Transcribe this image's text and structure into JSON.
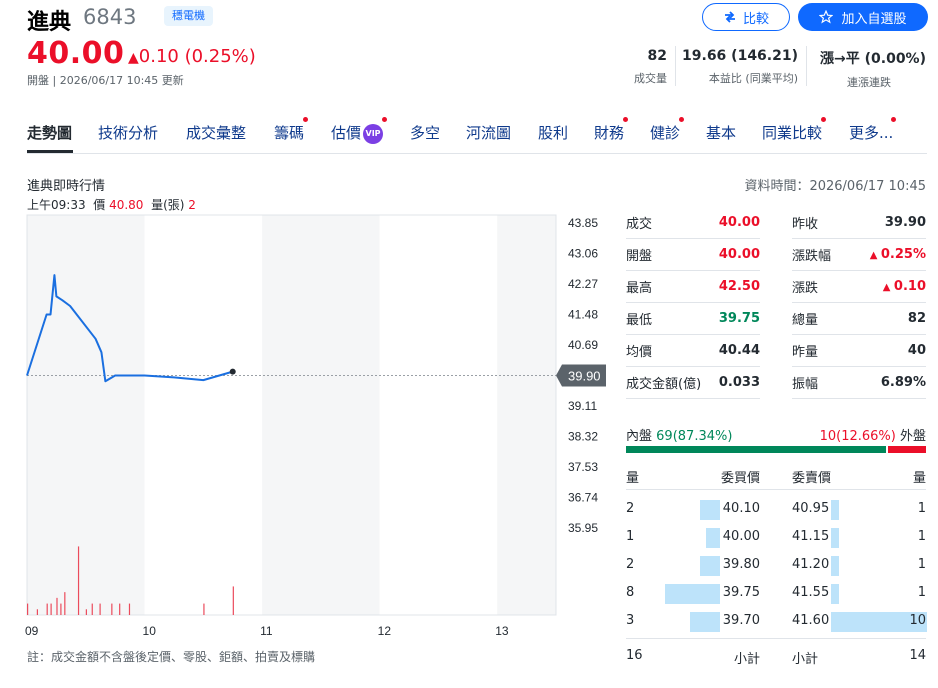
{
  "stock": {
    "name": "進典",
    "code": "6843",
    "industry": "穩電機",
    "price": "40.00",
    "change": "0.10 (0.25%)",
    "market_status": "開盤",
    "updated": "2026/06/17 10:45 更新"
  },
  "buttons": {
    "compare": "比較",
    "watchlist": "加入自選股"
  },
  "header_stats": [
    {
      "value": "82",
      "label": "成交量"
    },
    {
      "value": "19.66 (146.21)",
      "label": "本益比 (同業平均)"
    },
    {
      "value": "漲→平 (0.00%)",
      "label": "連漲連跌"
    }
  ],
  "tabs": [
    {
      "label": "走勢圖",
      "active": true
    },
    {
      "label": "技術分析"
    },
    {
      "label": "成交彙整"
    },
    {
      "label": "籌碼"
    },
    {
      "label": "估價",
      "badge": "VIP"
    },
    {
      "label": "多空"
    },
    {
      "label": "河流圖"
    },
    {
      "label": "股利"
    },
    {
      "label": "財務"
    },
    {
      "label": "健診"
    },
    {
      "label": "基本"
    },
    {
      "label": "同業比較"
    },
    {
      "label": "更多..."
    }
  ],
  "chart_section": {
    "title": "進典即時行情",
    "data_time": "資料時間：2026/06/17 10:45",
    "tooltip": {
      "time": "上午09:33",
      "price_label": "價",
      "price": "40.80",
      "volume_label": "量(張)",
      "volume": "2"
    },
    "footnote": "註：成交金額不含盤後定價、零股、鉅額、拍賣及標購"
  },
  "chart_data": {
    "type": "line",
    "y_ticks": [
      "43.85",
      "43.06",
      "42.27",
      "41.48",
      "40.69",
      "39.90",
      "39.11",
      "38.32",
      "37.53",
      "36.74",
      "35.95"
    ],
    "x_ticks": [
      "09",
      "10",
      "11",
      "12",
      "13"
    ],
    "reference_price": "39.90",
    "ylim": [
      35.95,
      43.85
    ],
    "price_series": [
      {
        "t": "09:00",
        "v": 39.9
      },
      {
        "t": "09:10",
        "v": 41.48
      },
      {
        "t": "09:12",
        "v": 41.48
      },
      {
        "t": "09:14",
        "v": 42.5
      },
      {
        "t": "09:15",
        "v": 41.95
      },
      {
        "t": "09:18",
        "v": 41.85
      },
      {
        "t": "09:22",
        "v": 41.7
      },
      {
        "t": "09:35",
        "v": 40.85
      },
      {
        "t": "09:38",
        "v": 40.5
      },
      {
        "t": "09:40",
        "v": 39.75
      },
      {
        "t": "09:45",
        "v": 39.9
      },
      {
        "t": "10:00",
        "v": 39.9
      },
      {
        "t": "10:15",
        "v": 39.85
      },
      {
        "t": "10:30",
        "v": 39.78
      },
      {
        "t": "10:45",
        "v": 40.0
      }
    ],
    "volume_series": [
      {
        "t": "09:00",
        "v": 2
      },
      {
        "t": "09:05",
        "v": 1
      },
      {
        "t": "09:10",
        "v": 2
      },
      {
        "t": "09:12",
        "v": 2
      },
      {
        "t": "09:15",
        "v": 3
      },
      {
        "t": "09:17",
        "v": 2
      },
      {
        "t": "09:19",
        "v": 4
      },
      {
        "t": "09:26",
        "v": 12
      },
      {
        "t": "09:30",
        "v": 1
      },
      {
        "t": "09:33",
        "v": 2
      },
      {
        "t": "09:37",
        "v": 2
      },
      {
        "t": "09:43",
        "v": 2
      },
      {
        "t": "09:47",
        "v": 2
      },
      {
        "t": "09:52",
        "v": 2
      },
      {
        "t": "10:30",
        "v": 2
      },
      {
        "t": "10:45",
        "v": 5
      }
    ],
    "volume_max": 14
  },
  "quote_table": {
    "left": [
      {
        "label": "成交",
        "value": "40.00",
        "color": "red"
      },
      {
        "label": "開盤",
        "value": "40.00",
        "color": "red"
      },
      {
        "label": "最高",
        "value": "42.50",
        "color": "red"
      },
      {
        "label": "最低",
        "value": "39.75",
        "color": "green"
      },
      {
        "label": "均價",
        "value": "40.44",
        "color": ""
      },
      {
        "label": "成交金額(億)",
        "value": "0.033",
        "color": ""
      }
    ],
    "right": [
      {
        "label": "昨收",
        "value": "39.90",
        "color": ""
      },
      {
        "label": "漲跌幅",
        "value": "0.25%",
        "color": "red",
        "arrow": true
      },
      {
        "label": "漲跌",
        "value": "0.10",
        "color": "red",
        "arrow": true
      },
      {
        "label": "總量",
        "value": "82",
        "color": ""
      },
      {
        "label": "昨量",
        "value": "40",
        "color": ""
      },
      {
        "label": "振幅",
        "value": "6.89%",
        "color": ""
      }
    ]
  },
  "inner_outer": {
    "inner_label": "內盤",
    "inner_value": "69",
    "inner_pct": "(87.34%)",
    "outer_value": "10",
    "outer_pct": "(12.66%)",
    "outer_label": "外盤",
    "inner_fraction": 0.8734
  },
  "order_book": {
    "headers": {
      "bid_qty": "量",
      "bid_price": "委買價",
      "ask_price": "委賣價",
      "ask_qty": "量"
    },
    "rows": [
      {
        "bid_qty": "2",
        "bid_price": "40.10",
        "ask_price": "40.95",
        "ask_qty": "1",
        "bid_n": 2,
        "ask_n": 1
      },
      {
        "bid_qty": "1",
        "bid_price": "40.00",
        "ask_price": "41.15",
        "ask_qty": "1",
        "bid_n": 1,
        "ask_n": 1
      },
      {
        "bid_qty": "2",
        "bid_price": "39.80",
        "ask_price": "41.20",
        "ask_qty": "1",
        "bid_n": 2,
        "ask_n": 1
      },
      {
        "bid_qty": "8",
        "bid_price": "39.75",
        "ask_price": "41.55",
        "ask_qty": "1",
        "bid_n": 8,
        "ask_n": 1
      },
      {
        "bid_qty": "3",
        "bid_price": "39.70",
        "ask_price": "41.60",
        "ask_qty": "10",
        "bid_n": 3,
        "ask_n": 10
      }
    ],
    "bid_total": "16",
    "bid_total_label": "小計",
    "ask_total_label": "小計",
    "ask_total": "14"
  }
}
